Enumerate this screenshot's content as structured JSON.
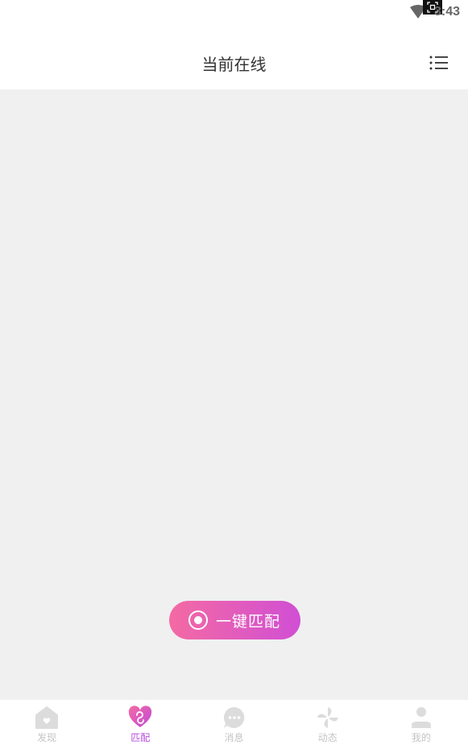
{
  "status_bar": {
    "time": "3:43"
  },
  "header": {
    "title": "当前在线",
    "menu_icon": "list-menu-icon"
  },
  "match_button": {
    "label": "一键匹配",
    "icon": "target-icon"
  },
  "tabs": [
    {
      "label": "发现",
      "icon": "home-heart-icon",
      "active": false
    },
    {
      "label": "匹配",
      "icon": "heart-match-icon",
      "active": true
    },
    {
      "label": "消息",
      "icon": "chat-bubble-icon",
      "active": false
    },
    {
      "label": "动态",
      "icon": "pinwheel-icon",
      "active": false
    },
    {
      "label": "我的",
      "icon": "person-icon",
      "active": false
    }
  ],
  "colors": {
    "accent_start": "#f46aa3",
    "accent_end": "#d04fd4",
    "tab_active": "#b749dd",
    "tab_inactive": "#c4c4c4",
    "background": "#f0f0f0"
  }
}
